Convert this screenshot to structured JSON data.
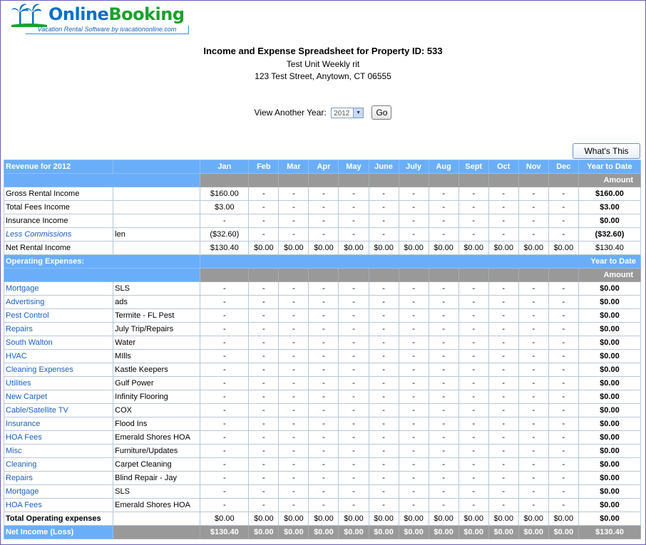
{
  "logo": {
    "word1": "Online",
    "word2": "Booking",
    "tagline": "Vacation Rental Software by ivacationonline.com",
    "icon": "palm-tree-icon",
    "colors": {
      "blue": "#0a6fc8",
      "green": "#1aa12b"
    }
  },
  "header": {
    "title": "Income and Expense Spreadsheet for Property ID: 533",
    "unit": "Test Unit Weekly rit",
    "address": "123 Test Street, Anytown, CT 06555"
  },
  "year_picker": {
    "label": "View Another Year:",
    "selected": "2012",
    "go_label": "Go"
  },
  "whats_this_label": "What's This",
  "columns": {
    "months": [
      "Jan",
      "Feb",
      "Mar",
      "Apr",
      "May",
      "June",
      "July",
      "Aug",
      "Sept",
      "Oct",
      "Nov",
      "Dec"
    ],
    "ytd": "Year to Date",
    "amount": "Amount"
  },
  "revenue": {
    "heading": "Revenue for 2012",
    "rows": [
      {
        "label": "Gross Rental Income",
        "note": "",
        "values": [
          "$160.00",
          "-",
          "-",
          "-",
          "-",
          "-",
          "-",
          "-",
          "-",
          "-",
          "-",
          "-"
        ],
        "ytd": "$160.00",
        "style": "plain"
      },
      {
        "label": "Total Fees Income",
        "note": "",
        "values": [
          "$3.00",
          "-",
          "-",
          "-",
          "-",
          "-",
          "-",
          "-",
          "-",
          "-",
          "-",
          "-"
        ],
        "ytd": "$3.00",
        "style": "plain"
      },
      {
        "label": "Insurance Income",
        "note": "",
        "values": [
          "-",
          "-",
          "-",
          "-",
          "-",
          "-",
          "-",
          "-",
          "-",
          "-",
          "-",
          "-"
        ],
        "ytd": "$0.00",
        "style": "plain"
      },
      {
        "label": "Less Commissions",
        "note": "len",
        "values": [
          "($32.60)",
          "-",
          "-",
          "-",
          "-",
          "-",
          "-",
          "-",
          "-",
          "-",
          "-",
          "-"
        ],
        "ytd": "($32.60)",
        "style": "link-italic"
      }
    ],
    "net": {
      "label": "Net Rental Income",
      "values": [
        "$130.40",
        "$0.00",
        "$0.00",
        "$0.00",
        "$0.00",
        "$0.00",
        "$0.00",
        "$0.00",
        "$0.00",
        "$0.00",
        "$0.00",
        "$0.00"
      ],
      "ytd": "$130.40"
    }
  },
  "expenses": {
    "heading": "Operating Expenses:",
    "rows": [
      {
        "label": "Mortgage",
        "note": "SLS",
        "ytd": "$0.00"
      },
      {
        "label": "Advertising",
        "note": "ads",
        "ytd": "$0.00"
      },
      {
        "label": "Pest Control",
        "note": "Termite - FL Pest",
        "ytd": "$0.00"
      },
      {
        "label": "Repairs",
        "note": "July Trip/Repairs",
        "ytd": "$0.00"
      },
      {
        "label": "South Walton",
        "note": "Water",
        "ytd": "$0.00"
      },
      {
        "label": "HVAC",
        "note": "MIlls",
        "ytd": "$0.00"
      },
      {
        "label": "Cleaning Expenses",
        "note": "Kastle Keepers",
        "ytd": "$0.00"
      },
      {
        "label": "Utilities",
        "note": "Gulf Power",
        "ytd": "$0.00"
      },
      {
        "label": "New Carpet",
        "note": "Infinity Flooring",
        "ytd": "$0.00"
      },
      {
        "label": "Cable/Satellite TV",
        "note": "COX",
        "ytd": "$0.00"
      },
      {
        "label": "Insurance",
        "note": "Flood Ins",
        "ytd": "$0.00"
      },
      {
        "label": "HOA Fees",
        "note": "Emerald Shores HOA",
        "ytd": "$0.00"
      },
      {
        "label": "Misc",
        "note": "Furniture/Updates",
        "ytd": "$0.00"
      },
      {
        "label": "Cleaning",
        "note": "Carpet Cleaning",
        "ytd": "$0.00"
      },
      {
        "label": "Repairs",
        "note": "Blind Repair - Jay",
        "ytd": "$0.00"
      },
      {
        "label": "Mortgage",
        "note": "SLS",
        "ytd": "$0.00"
      },
      {
        "label": "HOA Fees",
        "note": "Emerald Shores HOA",
        "ytd": "$0.00"
      }
    ],
    "dash": "-",
    "total": {
      "label": "Total Operating expenses",
      "values": [
        "$0.00",
        "$0.00",
        "$0.00",
        "$0.00",
        "$0.00",
        "$0.00",
        "$0.00",
        "$0.00",
        "$0.00",
        "$0.00",
        "$0.00",
        "$0.00"
      ],
      "ytd": "$0.00"
    }
  },
  "net_income": {
    "label": "Net Income (Loss)",
    "values": [
      "$130.40",
      "$0.00",
      "$0.00",
      "$0.00",
      "$0.00",
      "$0.00",
      "$0.00",
      "$0.00",
      "$0.00",
      "$0.00",
      "$0.00",
      "$0.00"
    ],
    "ytd": "$130.40"
  },
  "colors": {
    "header_blue": "#6aaefa",
    "header_gray": "#999999",
    "link_blue": "#1a5fc0"
  }
}
